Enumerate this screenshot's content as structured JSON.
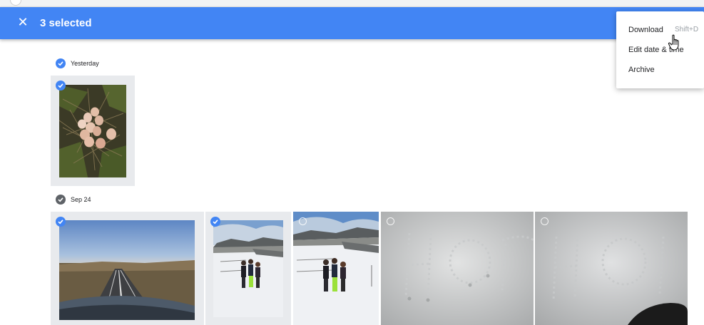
{
  "selection_bar": {
    "close_icon": "close-icon",
    "count_label": "3 selected",
    "color": "#4285f4"
  },
  "menu": {
    "items": [
      {
        "label": "Download",
        "shortcut": "Shift+D"
      },
      {
        "label": "Edit date & time"
      },
      {
        "label": "Archive"
      }
    ]
  },
  "groups": [
    {
      "date": "Yesterday",
      "selected": true
    },
    {
      "date": "Sep 24",
      "selected": false
    }
  ],
  "photos": [
    {
      "group": "Yesterday",
      "subject": "eggs-in-nest",
      "selected": true
    },
    {
      "group": "Sep 24",
      "subject": "road-landscape",
      "selected": true
    },
    {
      "group": "Sep 24",
      "subject": "people-in-snow",
      "selected": true
    },
    {
      "group": "Sep 24",
      "subject": "people-in-snow",
      "selected": false
    },
    {
      "group": "Sep 24",
      "subject": "snow-letters",
      "selected": false
    },
    {
      "group": "Sep 24",
      "subject": "snow-letters",
      "selected": false
    }
  ]
}
